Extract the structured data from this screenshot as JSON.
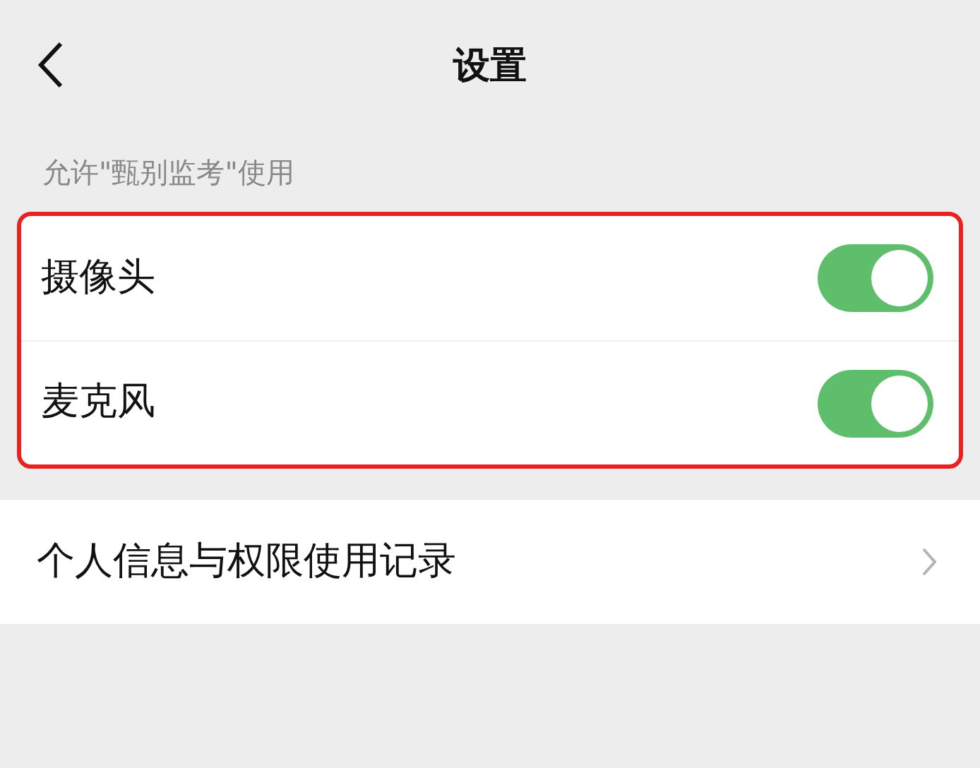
{
  "header": {
    "title": "设置"
  },
  "section": {
    "label": "允许\"甄别监考\"使用"
  },
  "permissions": [
    {
      "label": "摄像头",
      "on": true
    },
    {
      "label": "麦克风",
      "on": true
    }
  ],
  "links": [
    {
      "label": "个人信息与权限使用记录"
    }
  ]
}
